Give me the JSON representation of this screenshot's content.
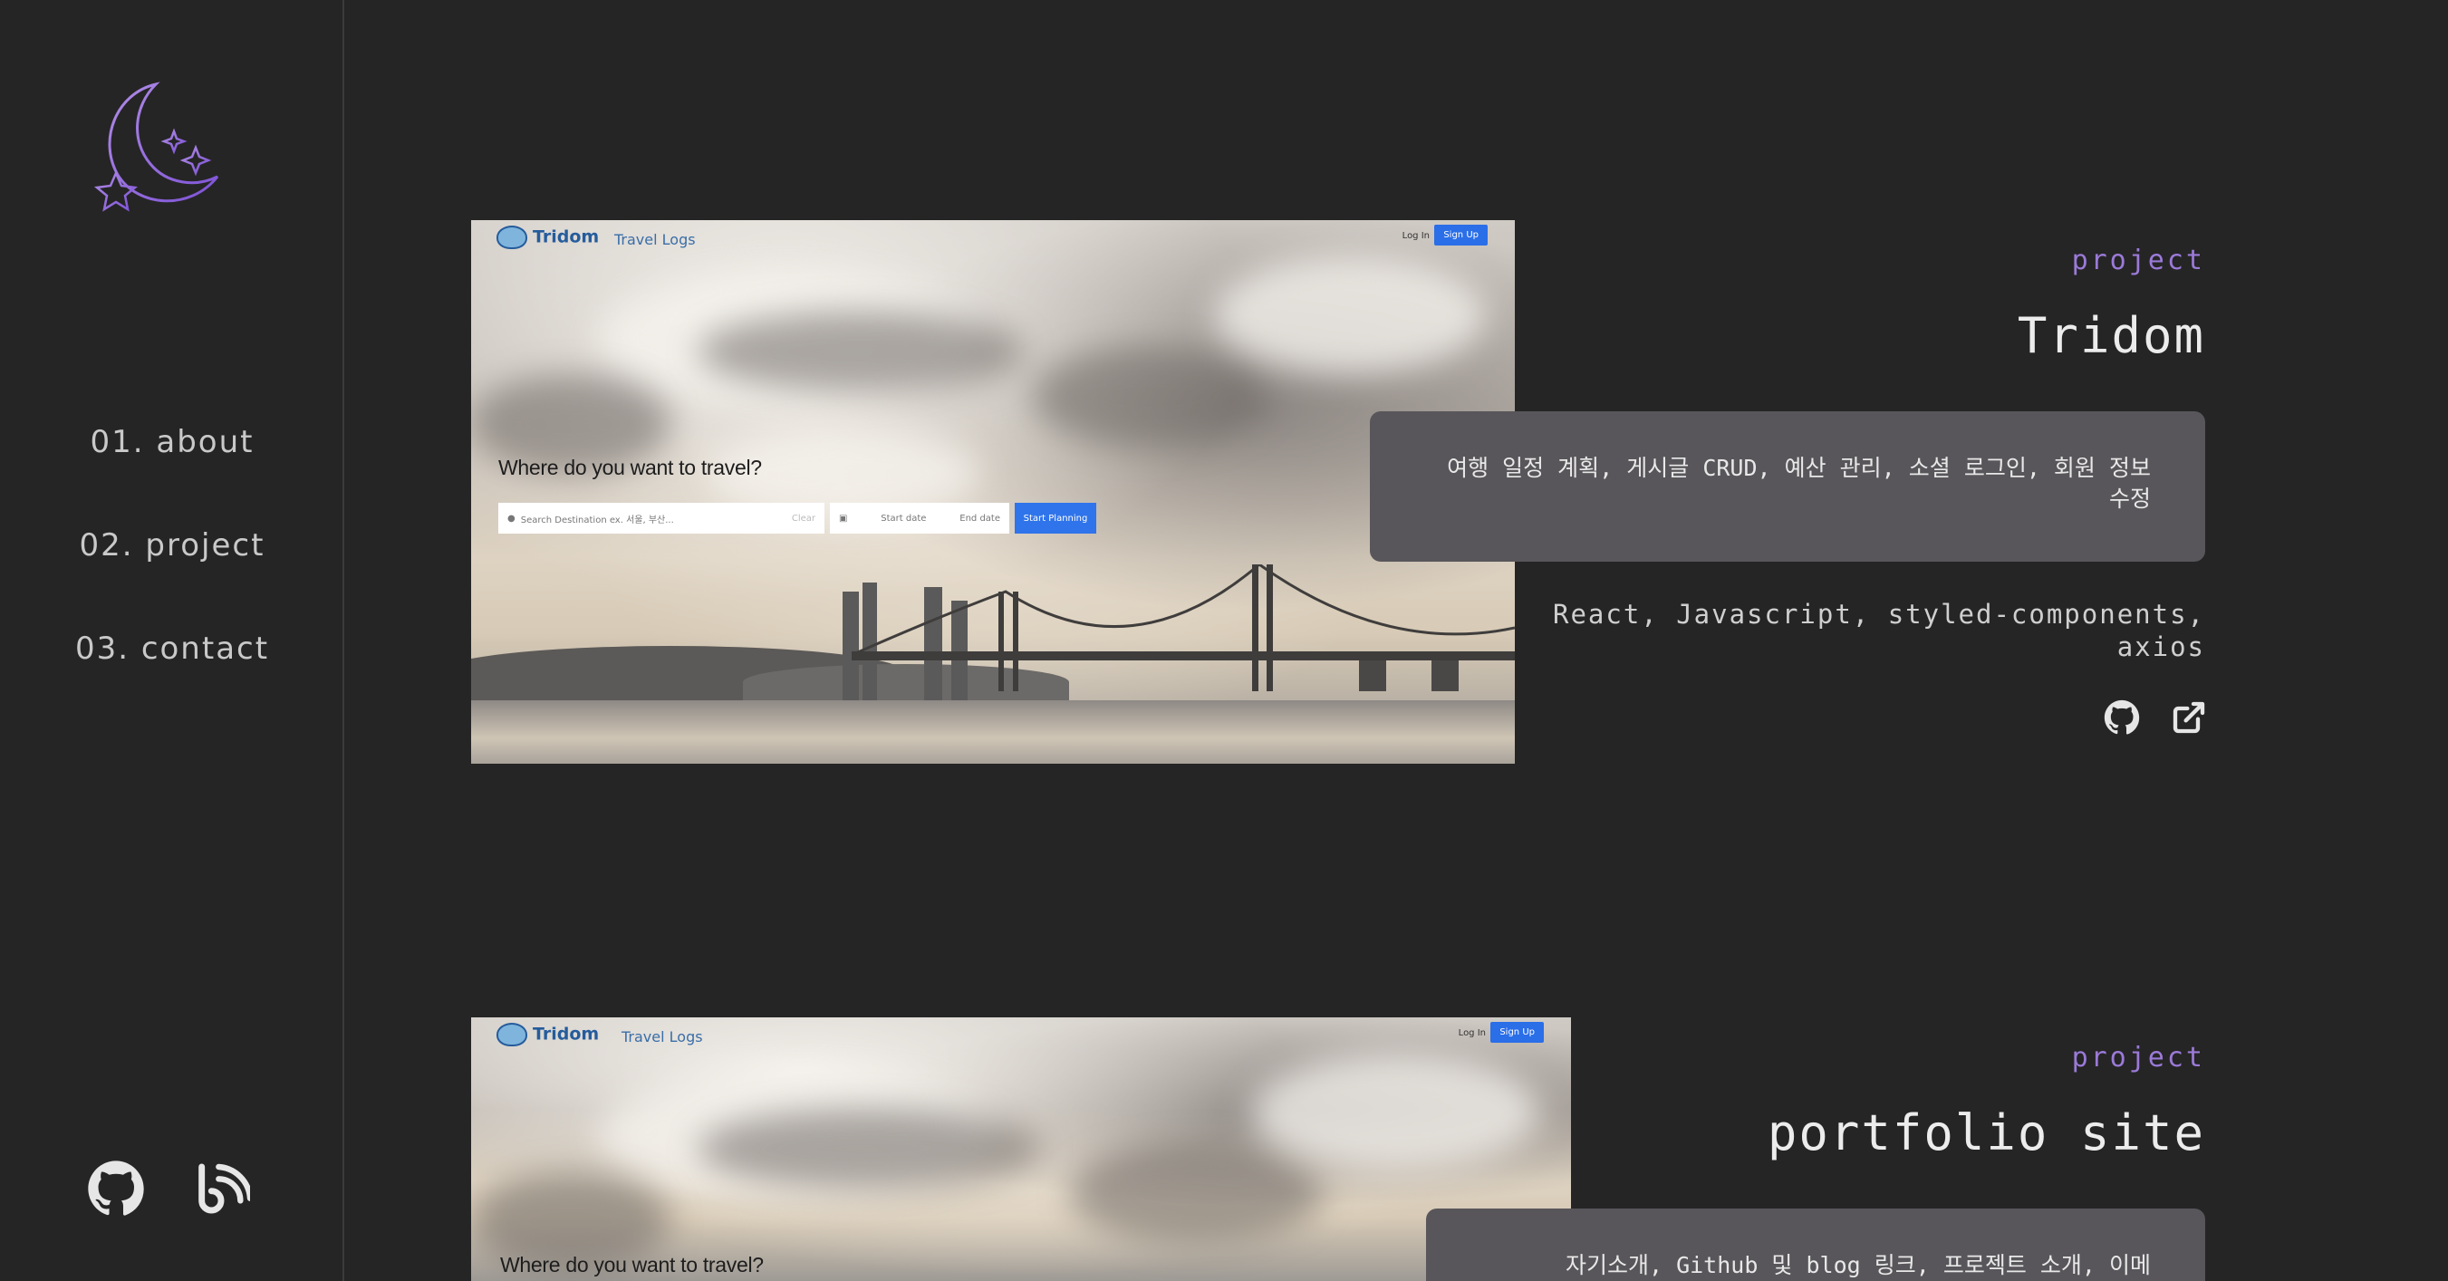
{
  "sidebar": {
    "logo": "moon-stars-logo",
    "nav": [
      {
        "label": "01. about"
      },
      {
        "label": "02. project"
      },
      {
        "label": "03. contact"
      }
    ],
    "links": [
      "github-icon",
      "blog-icon"
    ]
  },
  "colors": {
    "background": "#252525",
    "accent": "#9b7ad8",
    "card": "#58565a",
    "signup_button": "#2a6ee8"
  },
  "projects": [
    {
      "label": "project",
      "title": "Tridom",
      "description": "여행 일정 계획, 게시글 CRUD, 예산 관리, 소셜 로그인, 회원 정보 수정",
      "tech": "React, Javascript, styled-components, axios",
      "links": [
        "github-icon",
        "external-link-icon"
      ],
      "screenshot": {
        "brand": "Tridom",
        "tab": "Travel Logs",
        "login": "Log In",
        "signup": "Sign Up",
        "headline": "Where do you want to travel?",
        "search_placeholder": "Search Destination ex. 서울, 부산...",
        "clear": "Clear",
        "start_date": "Start date",
        "end_date": "End date",
        "start_button": "Start Planning"
      }
    },
    {
      "label": "project",
      "title": "portfolio site",
      "description": "자기소개, Github 및 blog 링크, 프로젝트 소개, 이메",
      "screenshot": {
        "brand": "Tridom",
        "tab": "Travel Logs",
        "login": "Log In",
        "signup": "Sign Up",
        "headline": "Where do you want to travel?"
      }
    }
  ]
}
